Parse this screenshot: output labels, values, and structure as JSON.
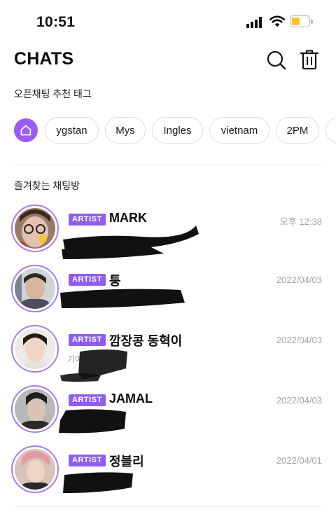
{
  "status_bar": {
    "time": "10:51"
  },
  "header": {
    "title": "CHATS"
  },
  "tags_section": {
    "title": "오픈채팅 추천 태그",
    "tags": [
      "ygstan",
      "Mys",
      "Ingles",
      "vietnam",
      "2PM"
    ]
  },
  "favorites_section": {
    "title": "즐겨찾는 채팅방"
  },
  "chats": [
    {
      "badge": "ARTIST",
      "name": "MARK",
      "time": "오후 12:38",
      "preview": ""
    },
    {
      "badge": "ARTIST",
      "name": "퉁",
      "time": "2022/04/03",
      "preview": ""
    },
    {
      "badge": "ARTIST",
      "name": "깜장콩 동혁이",
      "time": "2022/04/03",
      "preview": "기여미"
    },
    {
      "badge": "ARTIST",
      "name": "JAMAL",
      "time": "2022/04/03",
      "preview": ""
    },
    {
      "badge": "ARTIST",
      "name": "정블리",
      "time": "2022/04/01",
      "preview": ""
    }
  ],
  "colors": {
    "accent": "#9b5cf3",
    "badge": "#8f5cf0",
    "battery": "#f7c42f"
  }
}
